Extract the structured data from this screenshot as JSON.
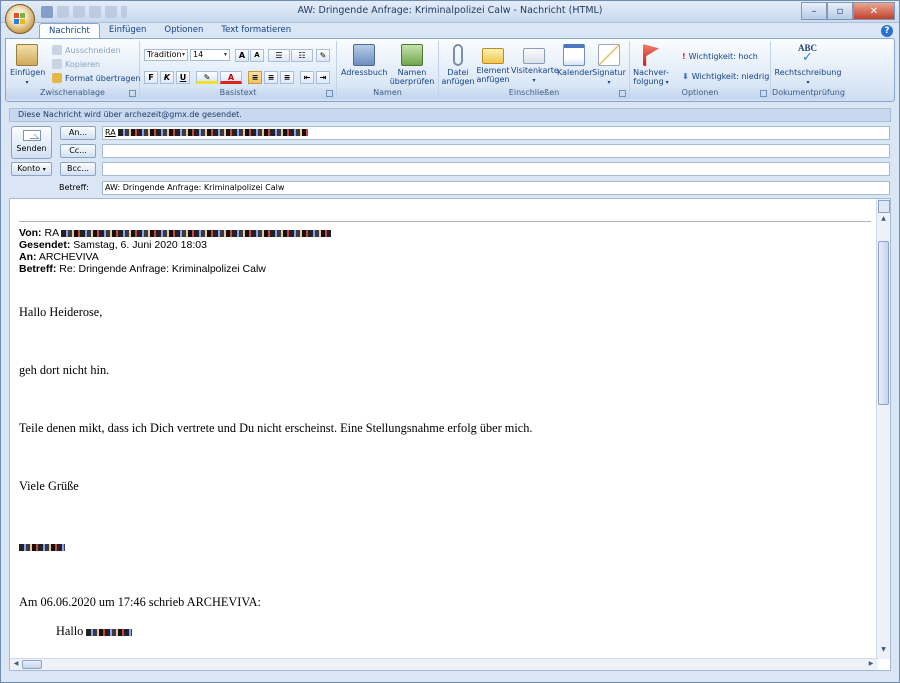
{
  "window": {
    "title": "AW: Dringende Anfrage: Kriminalpolizei Calw - Nachricht (HTML)"
  },
  "tabs": [
    {
      "label": "Nachricht",
      "active": true
    },
    {
      "label": "Einfügen"
    },
    {
      "label": "Optionen"
    },
    {
      "label": "Text formatieren"
    }
  ],
  "ribbon": {
    "clipboard": {
      "paste_label": "Einfügen",
      "cut_label": "Ausschneiden",
      "copy_label": "Kopieren",
      "format_painter_label": "Format übertragen",
      "group_label": "Zwischenablage"
    },
    "basictext": {
      "font_name": "Tradition",
      "font_size": "14",
      "bold_label": "F",
      "italic_label": "K",
      "underline_label": "U",
      "group_label": "Basistext"
    },
    "names": {
      "addressbook_label": "Adressbuch",
      "checknames_label": "Namen überprüfen",
      "group_label": "Namen"
    },
    "include": {
      "attach_file_label": "Datei anfügen",
      "attach_item_label": "Element anfügen",
      "vcard_label": "Visitenkarte",
      "calendar_label": "Kalender",
      "signature_label": "Signatur",
      "group_label": "Einschließen"
    },
    "options": {
      "followup_label": "Nachver- folgung",
      "importance_high_label": "Wichtigkeit: hoch",
      "importance_low_label": "Wichtigkeit: niedrig",
      "group_label": "Optionen"
    },
    "proofing": {
      "spelling_label": "Rechtschreibung",
      "abc_label": "ABC",
      "group_label": "Dokumentprüfung"
    }
  },
  "infobar": {
    "text": "Diese Nachricht wird über archezeit@gmx.de gesendet."
  },
  "header": {
    "send_label": "Senden",
    "account_label": "Konto",
    "to_button": "An...",
    "cc_button": "Cc...",
    "bcc_button": "Bcc...",
    "to_value": "RA",
    "subject_label": "Betreff:",
    "subject_value": "AW: Dringende Anfrage: Kriminalpolizei Calw"
  },
  "message": {
    "from_label": "Von:",
    "from_value": "RA",
    "sent_label": "Gesendet:",
    "sent_value": "Samstag, 6. Juni 2020 18:03",
    "to_label": "An:",
    "to_value": "ARCHEVIVA",
    "subject_label": "Betreff:",
    "subject_value": "Re: Dringende Anfrage: Kriminalpolizei Calw",
    "greeting": "Hallo Heiderose,",
    "line1": "geh dort nicht hin.",
    "line2": "Teile denen mikt, dass ich Dich vertrete und Du nicht erscheinst. Eine Stellungsnahme erfolg über mich.",
    "closing": "Viele Grüße",
    "quote_intro": "Am 06.06.2020 um 17:46 schrieb ARCHEVIVA:",
    "quote_greeting": "Hallo"
  },
  "colors": {
    "ribbon_text": "#15428b",
    "frame": "#dbe6f4"
  }
}
